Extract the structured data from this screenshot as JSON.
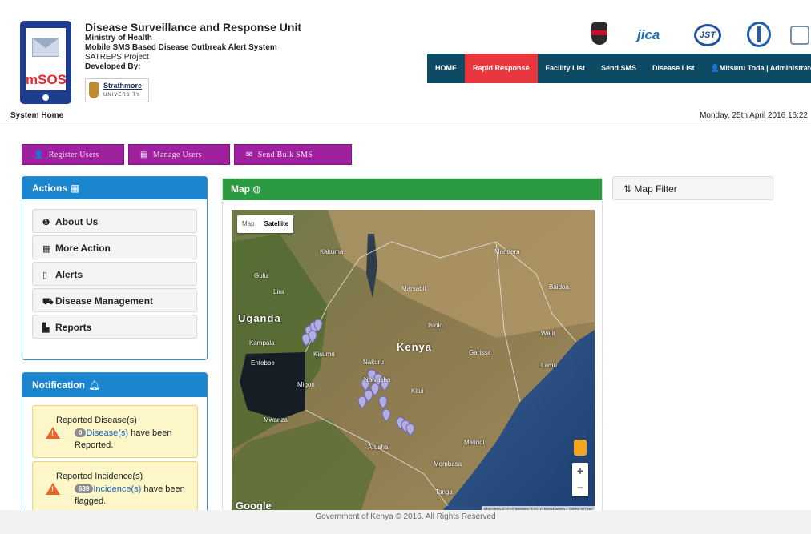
{
  "header": {
    "logo_text": "mSOS",
    "org_title": "Disease Surveillance and Response Unit",
    "ministry": "Ministry of Health",
    "system_name": "Mobile SMS Based Disease Outbreak Alert System",
    "project": "SATREPS Project",
    "developed_by": "Developed By:",
    "strathmore_name": "Strathmore",
    "strathmore_sub": "UNIVERSITY",
    "page_label": "System Home",
    "date": "Monday, 25th April 2016 16:22",
    "partner_logos": [
      "kenya-coat-of-arms",
      "jica-logo",
      "jst-logo",
      "medical-logo",
      "ministry-logo"
    ],
    "jica_text": "jica",
    "jst_text": "JST"
  },
  "nav": {
    "items": [
      {
        "label": "HOME",
        "active": false
      },
      {
        "label": "Rapid Response",
        "active": true
      },
      {
        "label": "Facility List",
        "active": false
      },
      {
        "label": "Send SMS",
        "active": false
      },
      {
        "label": "Disease List",
        "active": false
      },
      {
        "label": "Mitsuru Toda | Administrato",
        "active": false
      }
    ],
    "colors": {
      "bar": "#0d4a64",
      "active": "#e8383d"
    }
  },
  "toolbar": {
    "buttons": [
      {
        "label": "Register Users",
        "icon": "user-icon"
      },
      {
        "label": "Manage Users",
        "icon": "list-icon"
      },
      {
        "label": "Send Bulk SMS",
        "icon": "envelope-icon"
      }
    ],
    "color": "#a021a0"
  },
  "actions": {
    "title": "Actions",
    "items": [
      {
        "label": "About Us",
        "icon": "info-icon"
      },
      {
        "label": "More Action",
        "icon": "grid-icon"
      },
      {
        "label": "Alerts",
        "icon": "mobile-icon"
      },
      {
        "label": "Disease Management",
        "icon": "ambulance-icon"
      },
      {
        "label": "Reports",
        "icon": "file-icon"
      }
    ]
  },
  "notification": {
    "title": "Notification",
    "alerts": [
      {
        "title": "Reported Disease(s)",
        "count": "0",
        "link": "Disease(s)",
        "text1": " have been",
        "text2": "Reported."
      },
      {
        "title": "Reported Incidence(s)",
        "count": "639",
        "link": "Incidence(s)",
        "text1": " have been",
        "text2": "flagged."
      }
    ]
  },
  "map": {
    "title": "Map",
    "type_options": [
      {
        "label": "Map",
        "selected": false
      },
      {
        "label": "Satellite",
        "selected": true
      }
    ],
    "places": [
      "Uganda",
      "Kenya",
      "Kakuma",
      "Mandera",
      "Gulu",
      "Lira",
      "Kampala",
      "Entebbe",
      "Kisumu",
      "Nakuru",
      "Migori",
      "Mwanza",
      "Arusha",
      "Mombasa",
      "Tanga",
      "Marsabit",
      "Wajir",
      "Garissa",
      "Lamu",
      "Malindi",
      "Isiolo",
      "Naivasha",
      "Kitui",
      "Baidoa"
    ],
    "google_label": "Google",
    "attribution": "Map data ©2016 Imagery ©2016 TerraMetrics | Terms of Use",
    "zoom_in": "+",
    "zoom_out": "−"
  },
  "map_filter": {
    "label": "Map Filter",
    "icon": "sort-icon"
  },
  "footer": {
    "text": "Government of Kenya © 2016. All Rights Reserved"
  }
}
